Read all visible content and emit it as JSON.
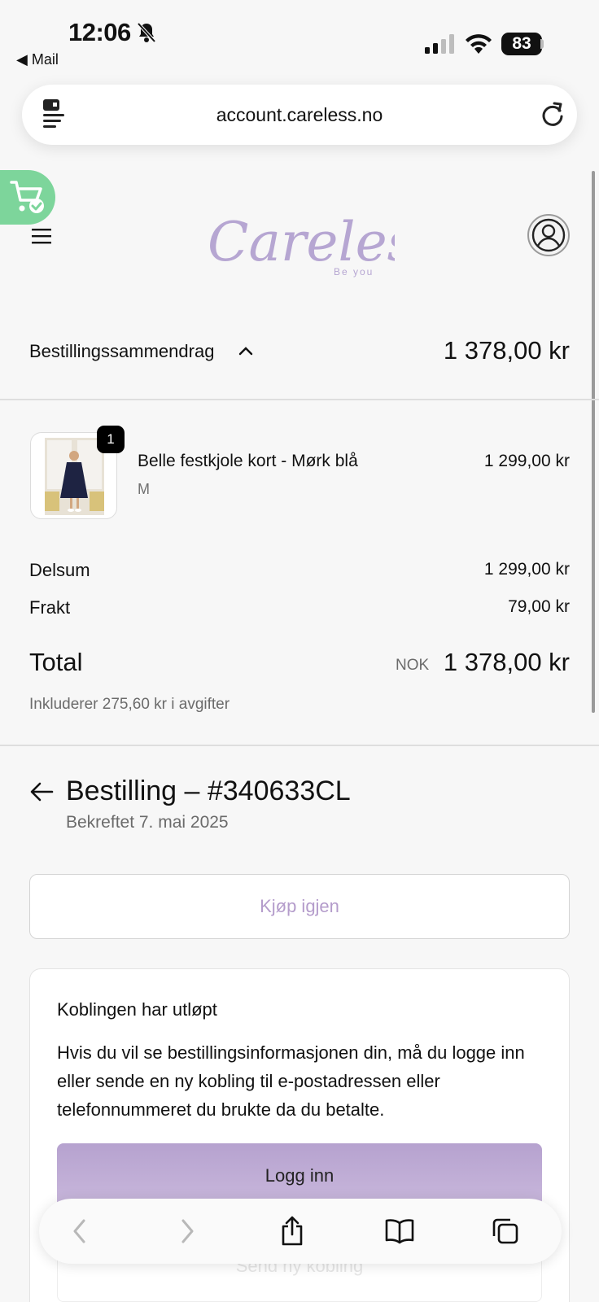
{
  "status_bar": {
    "time": "12:06",
    "back_app": "◀ Mail",
    "battery": "83"
  },
  "browser": {
    "url": "account.careless.no"
  },
  "header": {
    "logo_text": "Careless",
    "logo_tagline": "Be you"
  },
  "summary": {
    "label": "Bestillingssammendrag",
    "total": "1 378,00 kr",
    "item": {
      "quantity": "1",
      "name": "Belle festkjole kort - Mørk blå",
      "variant": "M",
      "price": "1 299,00 kr"
    },
    "subtotal_label": "Delsum",
    "subtotal_value": "1 299,00 kr",
    "shipping_label": "Frakt",
    "shipping_value": "79,00 kr",
    "total_label": "Total",
    "currency": "NOK",
    "total_value": "1 378,00 kr",
    "taxes_note": "Inkluderer 275,60 kr i avgifter"
  },
  "order": {
    "title": "Bestilling – #340633CL",
    "confirmed": "Bekreftet 7. mai 2025",
    "buy_again": "Kjøp igjen"
  },
  "expired_card": {
    "title": "Koblingen har utløpt",
    "body": "Hvis du vil se bestillingsinformasjonen din, må du logge inn eller sende en ny kobling til e-postadressen eller telefonnummeret du brukte da du betalte.",
    "login_button": "Logg inn",
    "send_new_button": "Send ny kobling"
  },
  "colors": {
    "accent": "#b6a2cf",
    "cart_badge": "#7dd59b"
  }
}
